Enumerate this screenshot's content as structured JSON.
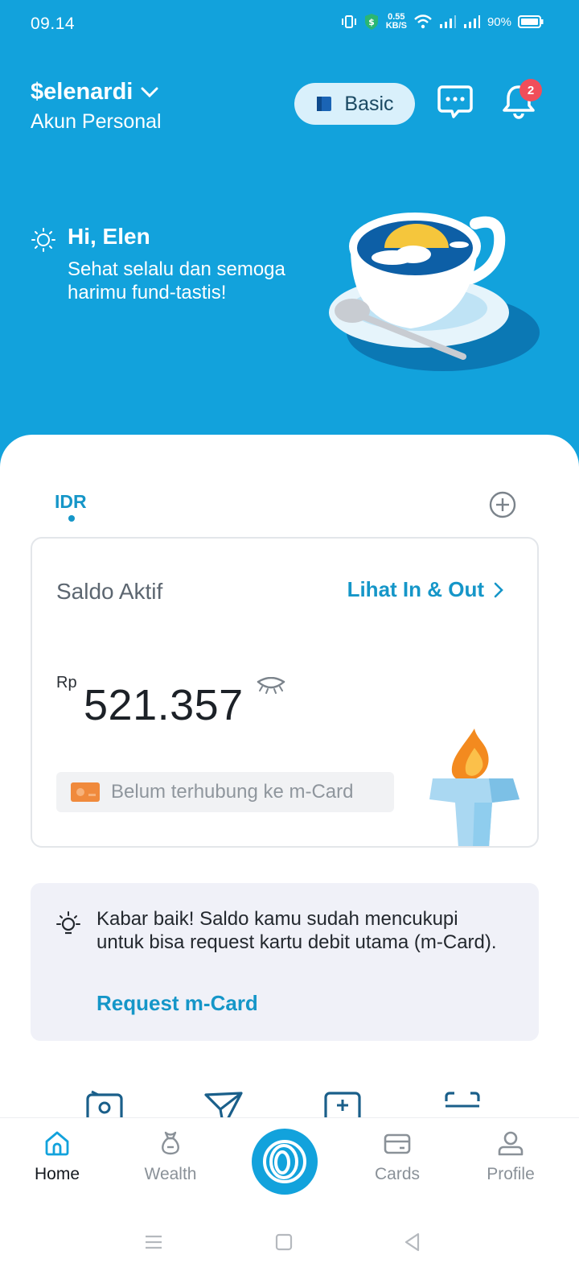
{
  "status": {
    "time": "09.14",
    "speed_value": "0.55",
    "speed_unit": "KB/S",
    "battery": "90%"
  },
  "header": {
    "account_name": "$elenardi",
    "account_type": "Akun Personal",
    "tier_label": "Basic",
    "notification_count": "2"
  },
  "greeting": {
    "title": "Hi, Elen",
    "subtitle": "Sehat selalu dan semoga harimu fund-tastis!"
  },
  "currency_tab": {
    "label": "IDR"
  },
  "balance": {
    "label": "Saldo Aktif",
    "link_label": "Lihat In & Out",
    "currency_symbol": "Rp",
    "amount": "521.357",
    "mcard_status": "Belum terhubung ke m-Card"
  },
  "info": {
    "text": "Kabar baik! Saldo kamu sudah mencukupi untuk bisa request kartu debit utama (m-Card).",
    "link_label": "Request m-Card"
  },
  "nav": {
    "home": "Home",
    "wealth": "Wealth",
    "cards": "Cards",
    "profile": "Profile"
  },
  "colors": {
    "brand": "#12a2dc",
    "link": "#1596c8",
    "badge": "#f04e5a"
  }
}
